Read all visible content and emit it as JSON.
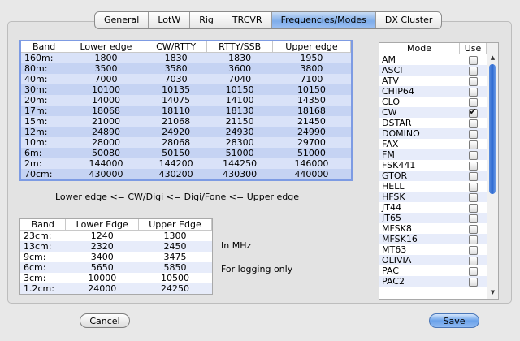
{
  "tabs": [
    {
      "label": "General",
      "active": false
    },
    {
      "label": "LotW",
      "active": false
    },
    {
      "label": "Rig",
      "active": false
    },
    {
      "label": "TRCVR",
      "active": false
    },
    {
      "label": "Frequencies/Modes",
      "active": true
    },
    {
      "label": "DX Cluster",
      "active": false
    }
  ],
  "band_table": {
    "headers": [
      "Band",
      "Lower edge",
      "CW/RTTY",
      "RTTY/SSB",
      "Upper edge"
    ],
    "rows": [
      [
        "160m:",
        "1800",
        "1830",
        "1830",
        "1950"
      ],
      [
        "80m:",
        "3500",
        "3580",
        "3600",
        "3800"
      ],
      [
        "40m:",
        "7000",
        "7030",
        "7040",
        "7100"
      ],
      [
        "30m:",
        "10100",
        "10135",
        "10150",
        "10150"
      ],
      [
        "20m:",
        "14000",
        "14075",
        "14100",
        "14350"
      ],
      [
        "17m:",
        "18068",
        "18110",
        "18130",
        "18168"
      ],
      [
        "15m:",
        "21000",
        "21068",
        "21150",
        "21450"
      ],
      [
        "12m:",
        "24890",
        "24920",
        "24930",
        "24990"
      ],
      [
        "10m:",
        "28000",
        "28068",
        "28300",
        "29700"
      ],
      [
        "6m:",
        "50080",
        "50150",
        "51000",
        "51000"
      ],
      [
        "2m:",
        "144000",
        "144200",
        "144250",
        "146000"
      ],
      [
        "70cm:",
        "430000",
        "430200",
        "430300",
        "440000"
      ]
    ]
  },
  "edge_caption": "Lower edge  <=  CW/Digi  <=  Digi/Fone  <=  Upper edge",
  "logging_table": {
    "headers": [
      "Band",
      "Lower Edge",
      "Upper Edge"
    ],
    "rows": [
      [
        "23cm:",
        "1240",
        "1300"
      ],
      [
        "13cm:",
        "2320",
        "2450"
      ],
      [
        "9cm:",
        "3400",
        "3475"
      ],
      [
        "6cm:",
        "5650",
        "5850"
      ],
      [
        "3cm:",
        "10000",
        "10500"
      ],
      [
        "1.2cm:",
        "24000",
        "24250"
      ]
    ]
  },
  "in_mhz_label": "In MHz",
  "logging_only_label": "For logging only",
  "modes_table": {
    "headers": [
      "Mode",
      "Use"
    ],
    "rows": [
      {
        "mode": "AM",
        "use": false
      },
      {
        "mode": "ASCI",
        "use": false
      },
      {
        "mode": "ATV",
        "use": false
      },
      {
        "mode": "CHIP64",
        "use": false
      },
      {
        "mode": "CLO",
        "use": false
      },
      {
        "mode": "CW",
        "use": true
      },
      {
        "mode": "DSTAR",
        "use": false
      },
      {
        "mode": "DOMINO",
        "use": false
      },
      {
        "mode": "FAX",
        "use": false
      },
      {
        "mode": "FM",
        "use": false
      },
      {
        "mode": "FSK441",
        "use": false
      },
      {
        "mode": "GTOR",
        "use": false
      },
      {
        "mode": "HELL",
        "use": false
      },
      {
        "mode": "HFSK",
        "use": false
      },
      {
        "mode": "JT44",
        "use": false
      },
      {
        "mode": "JT65",
        "use": false
      },
      {
        "mode": "MFSK8",
        "use": false
      },
      {
        "mode": "MFSK16",
        "use": false
      },
      {
        "mode": "MT63",
        "use": false
      },
      {
        "mode": "OLIVIA",
        "use": false
      },
      {
        "mode": "PAC",
        "use": false
      },
      {
        "mode": "PAC2",
        "use": false
      }
    ]
  },
  "buttons": {
    "cancel": "Cancel",
    "save": "Save"
  },
  "colors": {
    "accent": "#7fadea",
    "selection": "#c5d3f3",
    "stripe": "#e7ecfa"
  }
}
